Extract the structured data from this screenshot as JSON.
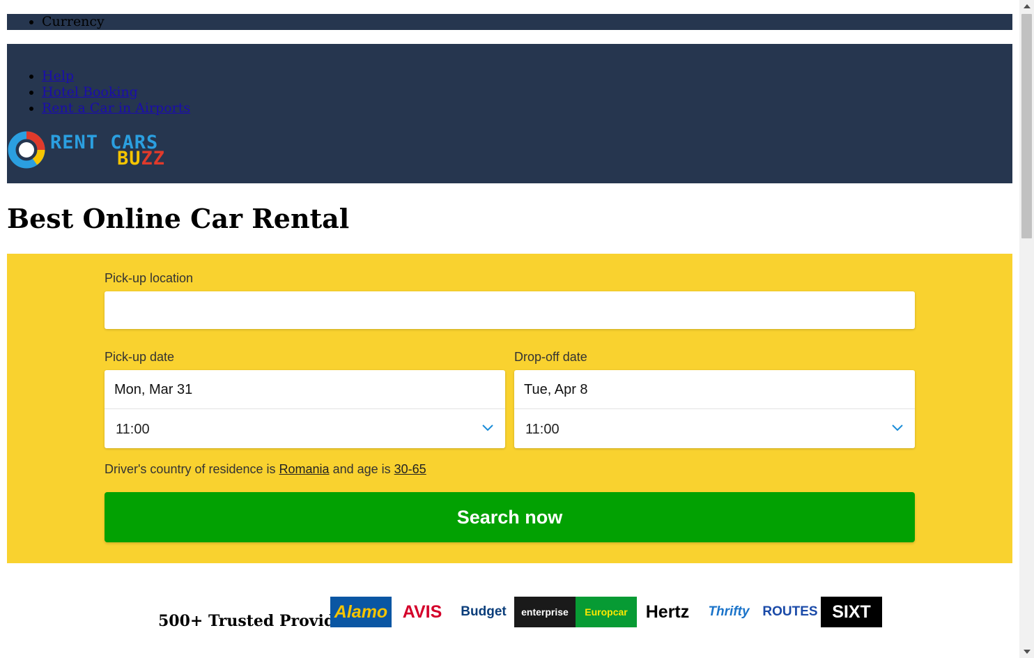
{
  "topbar": {
    "items": [
      "Currency"
    ]
  },
  "nav": {
    "links": [
      "Help",
      "Hotel Booking",
      "Rent a Car in Airports"
    ]
  },
  "logo": {
    "line1": "RENT CARS",
    "line2": [
      "B",
      "U",
      "Z",
      "Z"
    ]
  },
  "page": {
    "title": "Best Online Car Rental"
  },
  "search": {
    "pickup_location_label": "Pick-up location",
    "pickup_location_value": "",
    "pickup_date_label": "Pick-up date",
    "pickup_date": "Mon, Mar 31",
    "pickup_time": "11:00",
    "dropoff_date_label": "Drop-off date",
    "dropoff_date": "Tue, Apr 8",
    "dropoff_time": "11:00",
    "residence_prefix": "Driver's country of residence is ",
    "residence_country": "Romania",
    "residence_mid": " and age is ",
    "residence_age": "30-65",
    "button_label": "Search now"
  },
  "providers": {
    "label": "500+ Trusted Providers:",
    "logos": [
      {
        "name": "Alamo",
        "bg": "#0a56a3",
        "fg": "#f5c400"
      },
      {
        "name": "AVIS",
        "bg": "#ffffff",
        "fg": "#d4002a"
      },
      {
        "name": "Budget",
        "bg": "#ffffff",
        "fg": "#0a3d7a"
      },
      {
        "name": "enterprise",
        "bg": "#1a1a1a",
        "fg": "#ffffff"
      },
      {
        "name": "Europcar",
        "bg": "#079b34",
        "fg": "#ffe800"
      },
      {
        "name": "Hertz",
        "bg": "#ffffff",
        "fg": "#000000"
      },
      {
        "name": "Thrifty",
        "bg": "#ffffff",
        "fg": "#1a73c9"
      },
      {
        "name": "ROUTES",
        "bg": "#ffffff",
        "fg": "#1a4aa8"
      },
      {
        "name": "SIXT",
        "bg": "#000000",
        "fg": "#ffffff"
      }
    ]
  },
  "colors": {
    "header_bg": "#26364f",
    "search_bg": "#f9d22f",
    "button_bg": "#02a102"
  }
}
